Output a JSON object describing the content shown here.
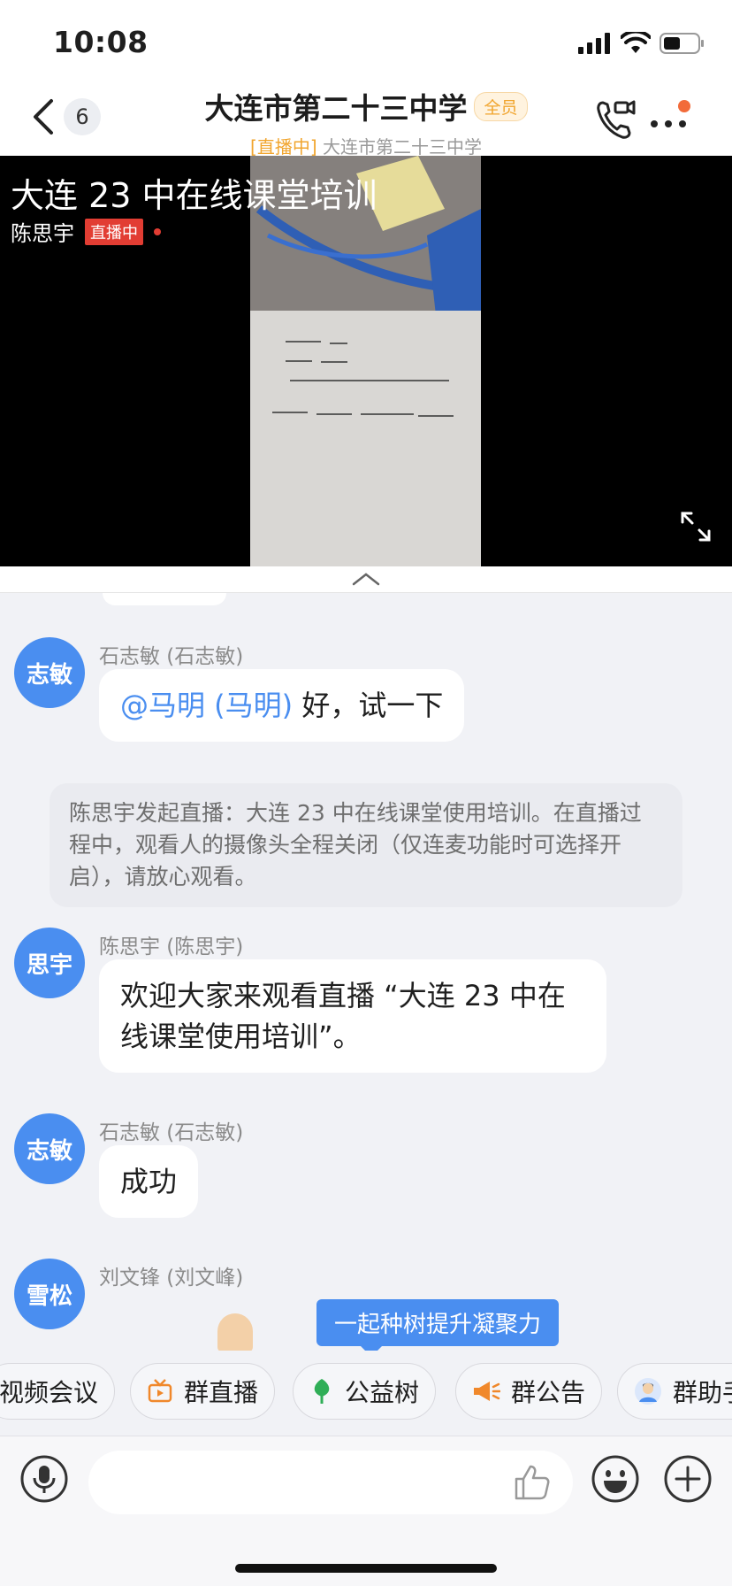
{
  "status_bar": {
    "time": "10:08"
  },
  "header": {
    "back_count": "6",
    "title": "大连市第二十三中学",
    "title_badge": "全员",
    "subtitle_live": "[直播中]",
    "subtitle_text": "大连市第二十三中学"
  },
  "video": {
    "title": "大连 23 中在线课堂培训",
    "presenter": "陈思宇",
    "live_tag": "直播中"
  },
  "messages": [
    {
      "avatar": "志敏",
      "sender": "石志敏 (石志敏)",
      "mention": "@马明 (马明)",
      "text": " 好，试一下"
    },
    {
      "system": "陈思宇发起直播：大连 23 中在线课堂使用培训。在直播过程中，观看人的摄像头全程关闭（仅连麦功能时可选择开启），请放心观看。"
    },
    {
      "avatar": "思宇",
      "sender": "陈思宇 (陈思宇)",
      "text": "欢迎大家来观看直播 “大连 23 中在线课堂使用培训”。"
    },
    {
      "avatar": "志敏",
      "sender": "石志敏 (石志敏)",
      "text": "成功"
    },
    {
      "avatar": "雪松",
      "sender": "刘文锋 (刘文峰)"
    }
  ],
  "tooltip": "一起种树提升凝聚力",
  "tools": [
    {
      "label": "视频会议",
      "icon": "video-meeting-icon"
    },
    {
      "label": "群直播",
      "icon": "live-tv-icon"
    },
    {
      "label": "公益树",
      "icon": "tree-icon"
    },
    {
      "label": "群公告",
      "icon": "megaphone-icon"
    },
    {
      "label": "群助手",
      "icon": "assistant-avatar-icon"
    }
  ],
  "colors": {
    "accent": "#4a8ef0",
    "live_red": "#e23d33",
    "badge_orange": "#f1a52e",
    "notify_orange": "#f26b3a"
  }
}
